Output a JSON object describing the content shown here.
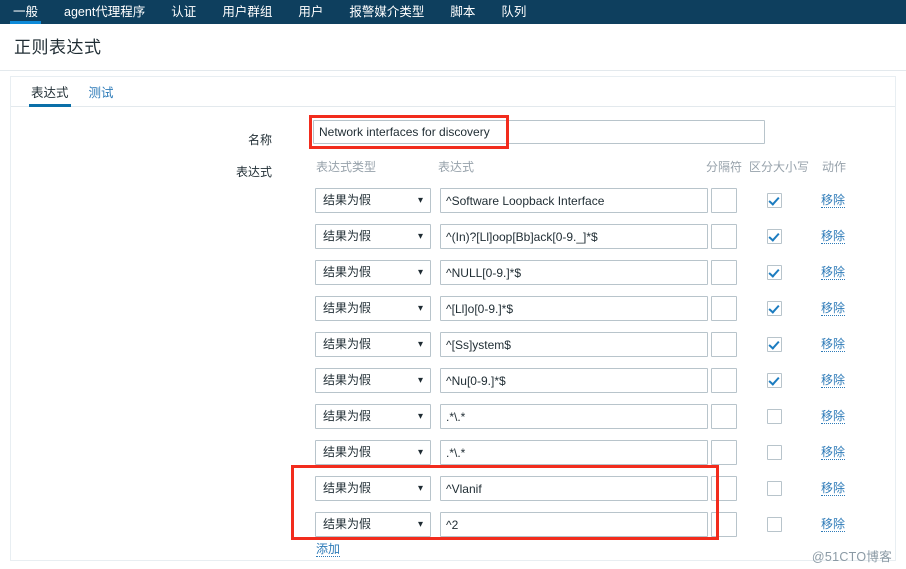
{
  "topnav": {
    "items": [
      {
        "label": "一般",
        "active": true
      },
      {
        "label": "agent代理程序",
        "active": false
      },
      {
        "label": "认证",
        "active": false
      },
      {
        "label": "用户群组",
        "active": false
      },
      {
        "label": "用户",
        "active": false
      },
      {
        "label": "报警媒介类型",
        "active": false
      },
      {
        "label": "脚本",
        "active": false
      },
      {
        "label": "队列",
        "active": false
      }
    ]
  },
  "page": {
    "title": "正则表达式",
    "watermark": "@51CTO博客"
  },
  "tabs": [
    {
      "label": "表达式",
      "active": true
    },
    {
      "label": "测试",
      "active": false
    }
  ],
  "form": {
    "name_label": "名称",
    "name_value": "Network interfaces for discovery",
    "name_placeholder": "",
    "expressions_label": "表达式",
    "add_label": "添加"
  },
  "table": {
    "headers": {
      "type": "表达式类型",
      "expression": "表达式",
      "delimiter": "分隔符",
      "case_sensitive": "区分大小写",
      "action": "动作"
    },
    "remove_label": "移除",
    "rows": [
      {
        "type": "结果为假",
        "expression": "^Software Loopback Interface",
        "delimiter": "",
        "case_sensitive": true
      },
      {
        "type": "结果为假",
        "expression": "^(In)?[Ll]oop[Bb]ack[0-9._]*$",
        "delimiter": "",
        "case_sensitive": true
      },
      {
        "type": "结果为假",
        "expression": "^NULL[0-9.]*$",
        "delimiter": "",
        "case_sensitive": true
      },
      {
        "type": "结果为假",
        "expression": "^[Ll]o[0-9.]*$",
        "delimiter": "",
        "case_sensitive": true
      },
      {
        "type": "结果为假",
        "expression": "^[Ss]ystem$",
        "delimiter": "",
        "case_sensitive": true
      },
      {
        "type": "结果为假",
        "expression": "^Nu[0-9.]*$",
        "delimiter": "",
        "case_sensitive": true
      },
      {
        "type": "结果为假",
        "expression": ".*\\.*",
        "delimiter": "",
        "case_sensitive": false
      },
      {
        "type": "结果为假",
        "expression": ".*\\.*",
        "delimiter": "",
        "case_sensitive": false
      },
      {
        "type": "结果为假",
        "expression": "^Vlanif",
        "delimiter": "",
        "case_sensitive": false
      },
      {
        "type": "结果为假",
        "expression": "^2",
        "delimiter": "",
        "case_sensitive": false
      }
    ]
  },
  "annotations": {
    "highlight_color": "#f22c1d",
    "boxes": [
      "name-field-highlight",
      "last-two-rows-highlight"
    ]
  },
  "icons": {
    "chevron_down": "⌄"
  }
}
